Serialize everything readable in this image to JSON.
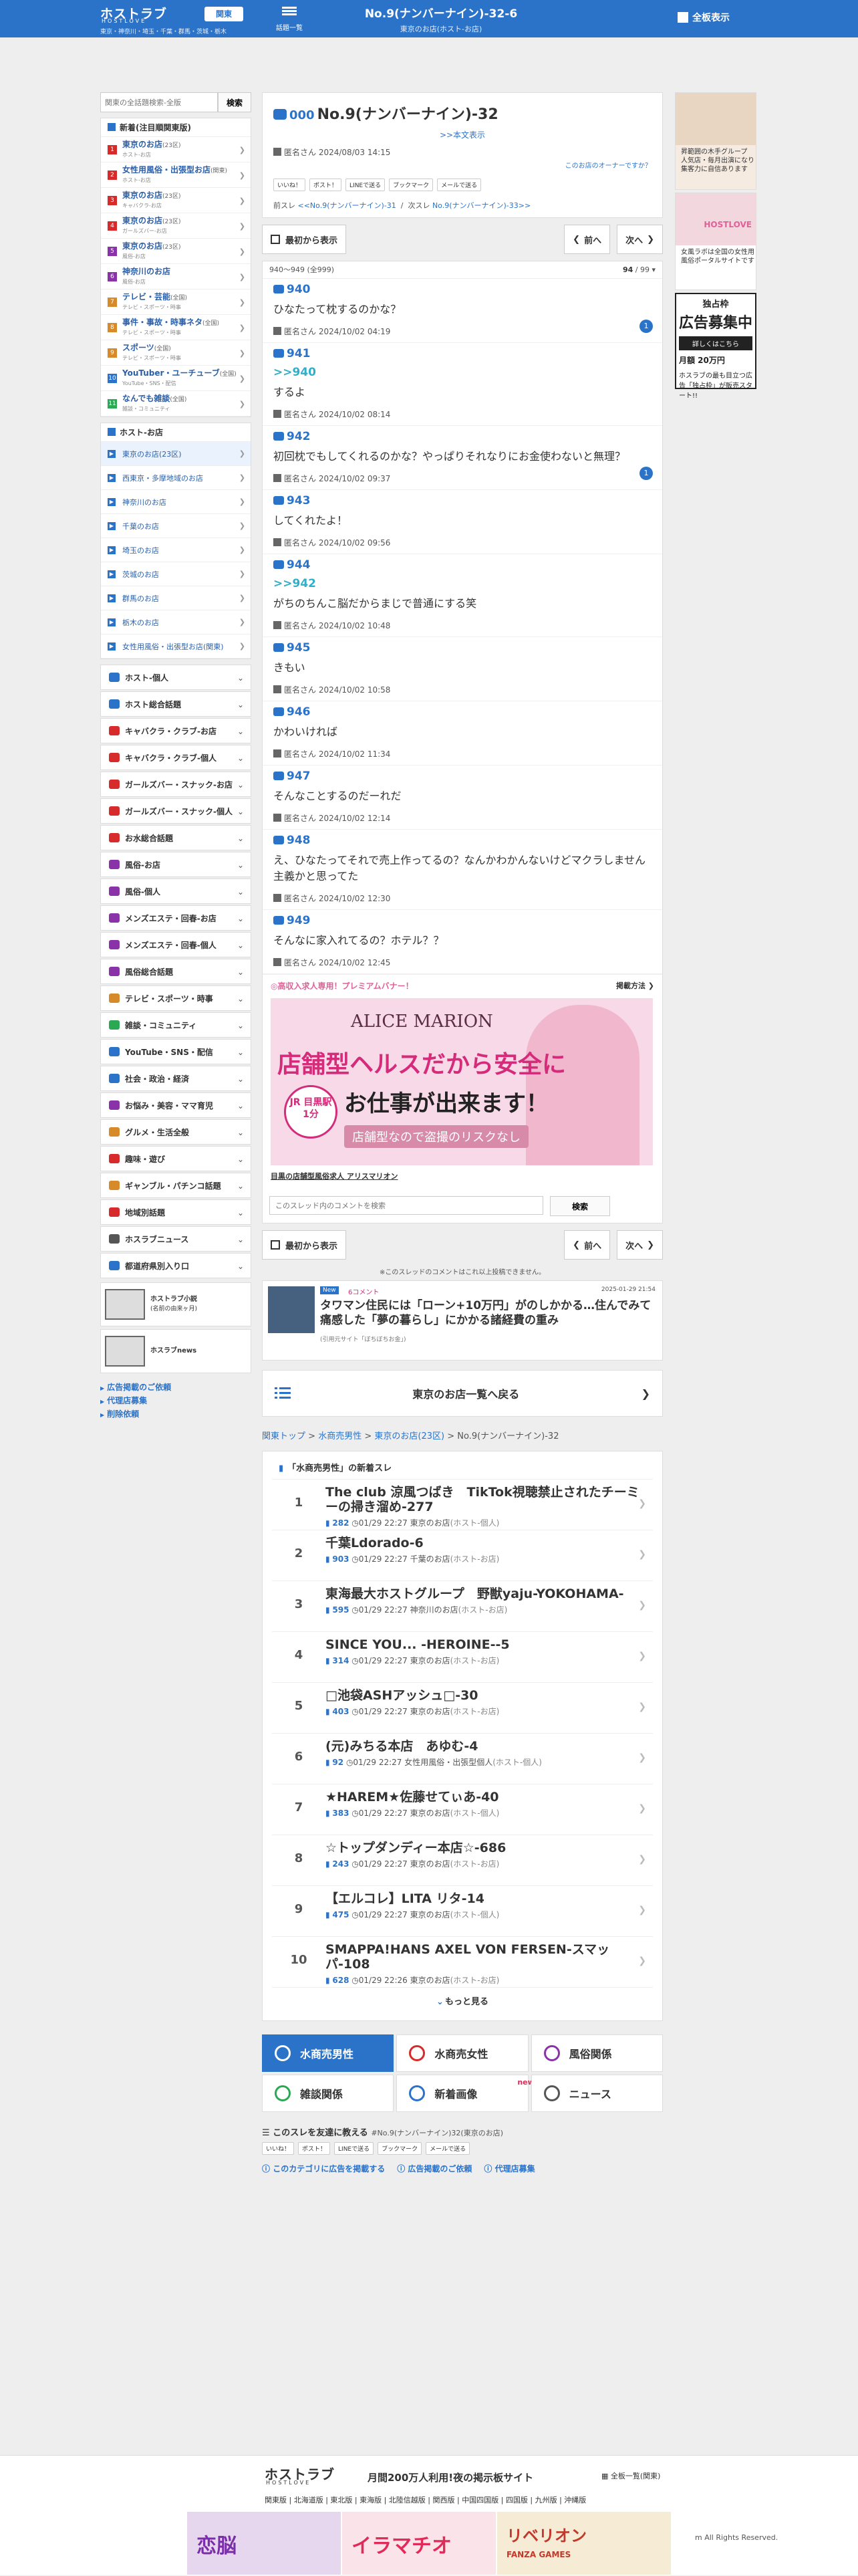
{
  "header": {
    "logo": "ホストラブ",
    "logo_sub": "HOSTLOVE",
    "region_line": "東京・神奈川・埼玉・千葉・群馬・茨城・栃木",
    "kanto_label": "関東",
    "menu_label": "話題一覧",
    "thread_title": "No.9(ナンバーナイン)-32-6",
    "thread_sub": "東京のお店(ホスト-お店)",
    "full_view": "全板表示"
  },
  "left": {
    "search_placeholder": "関東の全話題検索-全版",
    "search_button": "検索",
    "cat_head": "新着(注目順関東版)",
    "categories": [
      {
        "num": "1",
        "name": "東京のお店",
        "tag": "(23区)",
        "sub": "ホスト-お店",
        "color": "#d72a2a"
      },
      {
        "num": "2",
        "name": "女性用風俗・出張型お店",
        "tag": "(関東)",
        "sub": "ホスト-お店",
        "color": "#d72a2a"
      },
      {
        "num": "3",
        "name": "東京のお店",
        "tag": "(23区)",
        "sub": "キャバクラ-お店",
        "color": "#d72a2a"
      },
      {
        "num": "4",
        "name": "東京のお店",
        "tag": "(23区)",
        "sub": "ガールズバー-お店",
        "color": "#d72a2a"
      },
      {
        "num": "5",
        "name": "東京のお店",
        "tag": "(23区)",
        "sub": "風俗-お店",
        "color": "#8a33a8"
      },
      {
        "num": "6",
        "name": "神奈川のお店",
        "tag": "",
        "sub": "風俗-お店",
        "color": "#8a33a8"
      },
      {
        "num": "7",
        "name": "テレビ・芸能",
        "tag": "(全国)",
        "sub": "テレビ・スポーツ・時事",
        "color": "#d78a2a"
      },
      {
        "num": "8",
        "name": "事件・事故・時事ネタ",
        "tag": "(全国)",
        "sub": "テレビ・スポーツ・時事",
        "color": "#d78a2a"
      },
      {
        "num": "9",
        "name": "スポーツ",
        "tag": "(全国)",
        "sub": "テレビ・スポーツ・時事",
        "color": "#d78a2a"
      },
      {
        "num": "10",
        "name": "YouTuber・ユーチューブ",
        "tag": "(全国)",
        "sub": "YouTube・SNS・配信",
        "color": "#2b73c9"
      },
      {
        "num": "11",
        "name": "なんでも雑談",
        "tag": "(全国)",
        "sub": "雑談・コミュニティ",
        "color": "#2aa854"
      }
    ],
    "host_head": "ホスト-お店",
    "host_items": [
      "東京のお店(23区)",
      "西東京・多摩地域のお店",
      "神奈川のお店",
      "千葉のお店",
      "埼玉のお店",
      "茨城のお店",
      "群馬のお店",
      "栃木のお店",
      "女性用風俗・出張型お店(関東)"
    ],
    "genres": [
      {
        "name": "ホスト-個人",
        "color": "#2b73c9"
      },
      {
        "name": "ホスト総合話題",
        "color": "#2b73c9"
      },
      {
        "name": "キャバクラ・クラブ-お店",
        "color": "#d72a2a"
      },
      {
        "name": "キャバクラ・クラブ-個人",
        "color": "#d72a2a"
      },
      {
        "name": "ガールズバー・スナック-お店",
        "color": "#d72a2a"
      },
      {
        "name": "ガールズバー・スナック-個人",
        "color": "#d72a2a"
      },
      {
        "name": "お水総合話題",
        "color": "#d72a2a"
      },
      {
        "name": "風俗-お店",
        "color": "#8a33a8"
      },
      {
        "name": "風俗-個人",
        "color": "#8a33a8"
      },
      {
        "name": "メンズエステ・回春-お店",
        "color": "#8a33a8"
      },
      {
        "name": "メンズエステ・回春-個人",
        "color": "#8a33a8"
      },
      {
        "name": "風俗総合話題",
        "color": "#8a33a8"
      },
      {
        "name": "テレビ・スポーツ・時事",
        "color": "#d78a2a"
      },
      {
        "name": "雑談・コミュニティ",
        "color": "#2aa854"
      },
      {
        "name": "YouTube・SNS・配信",
        "color": "#2b73c9"
      },
      {
        "name": "社会・政治・経済",
        "color": "#2b73c9"
      },
      {
        "name": "お悩み・美容・ママ育児",
        "color": "#8a33a8"
      },
      {
        "name": "グルメ・生活全般",
        "color": "#d78a2a"
      },
      {
        "name": "趣味・遊び",
        "color": "#d72a2a"
      },
      {
        "name": "ギャンブル・パチンコ話題",
        "color": "#d78a2a"
      },
      {
        "name": "地域別話題",
        "color": "#d72a2a"
      },
      {
        "name": "ホスラブニュース",
        "color": "#555555"
      },
      {
        "name": "都道府県別入り口",
        "color": "#2b73c9"
      }
    ],
    "banner1": "ホストラブ小説",
    "banner1_sub": "(名前の由来ヶ月)",
    "banner2": "ホスラブnews",
    "links": [
      "広告掲載のご依頼",
      "代理店募集",
      "削除依頼"
    ]
  },
  "thread": {
    "count": "000",
    "title": "No.9(ナンバーナイン)-32",
    "body_link": ">>本文表示",
    "author": "匿名さん",
    "date": "2024/08/03 14:15",
    "owner_link": "このお店のオーナーですか？",
    "share": [
      "いいね！",
      "ポスト！",
      "LINEで送る",
      "ブックマーク",
      "メールで送る"
    ],
    "prev_label": "前スレ",
    "prev_thread": "<<No.9(ナンバーナイン)-31",
    "next_label": "次スレ",
    "next_thread": "No.9(ナンバーナイン)-33>>"
  },
  "nav": {
    "first": "最初から表示",
    "prev": "前へ",
    "next": "次へ"
  },
  "posts_header": {
    "range": "940〜949",
    "total": "(全999)",
    "page": "94",
    "pages": "99"
  },
  "posts": [
    {
      "no": "940",
      "anchor": "",
      "text": "ひなたって枕するのかな？",
      "author": "匿名さん",
      "date": "2024/10/02 04:19",
      "replies": "1"
    },
    {
      "no": "941",
      "anchor": ">>940",
      "text": "するよ",
      "author": "匿名さん",
      "date": "2024/10/02 08:14",
      "replies": ""
    },
    {
      "no": "942",
      "anchor": "",
      "text": "初回枕でもしてくれるのかな？やっぱりそれなりにお金使わないと無理？",
      "author": "匿名さん",
      "date": "2024/10/02 09:37",
      "replies": "1"
    },
    {
      "no": "943",
      "anchor": "",
      "text": "してくれたよ！",
      "author": "匿名さん",
      "date": "2024/10/02 09:56",
      "replies": ""
    },
    {
      "no": "944",
      "anchor": ">>942",
      "text": "がちのちんこ脳だからまじで普通にする笑",
      "author": "匿名さん",
      "date": "2024/10/02 10:48",
      "replies": ""
    },
    {
      "no": "945",
      "anchor": "",
      "text": "きもい",
      "author": "匿名さん",
      "date": "2024/10/02 10:58",
      "replies": ""
    },
    {
      "no": "946",
      "anchor": "",
      "text": "かわいければ",
      "author": "匿名さん",
      "date": "2024/10/02 11:34",
      "replies": ""
    },
    {
      "no": "947",
      "anchor": "",
      "text": "そんなことするのだーれだ",
      "author": "匿名さん",
      "date": "2024/10/02 12:14",
      "replies": ""
    },
    {
      "no": "948",
      "anchor": "",
      "text": "え、ひなたってそれで売上作ってるの？なんかわかんないけどマクラしません主義かと思ってた",
      "author": "匿名さん",
      "date": "2024/10/02 12:30",
      "replies": ""
    },
    {
      "no": "949",
      "anchor": "",
      "text": "そんなに家入れてるの？ホテル？？",
      "author": "匿名さん",
      "date": "2024/10/02 12:45",
      "replies": ""
    }
  ],
  "premium": {
    "head": "◎高収入求人専用！プレミアムバナー！",
    "method": "掲載方法",
    "brand": "ALICE MARION",
    "line1": "店舗型ヘルスだから安全に",
    "line2": "お仕事が出来ます！",
    "line3": "店舗型なので盗撮のリスクなし",
    "station": "JR 目黒駅 1分",
    "caption": "目黒の店舗型風俗求人 アリスマリオン"
  },
  "comment_search": {
    "placeholder": "このスレッド内のコメントを検索",
    "button": "検索",
    "limit_note": "※このスレッドのコメントはこれ以上投稿できません。"
  },
  "news": {
    "badge": "New",
    "comments": "6コメント",
    "date": "2025-01-29 21:54",
    "title": "タワマン住民には「ローン+10万円」がのしかかる…住んでみて痛感した「夢の暮らし」にかかる諸経費の重み",
    "source": "(引用元サイト「ぼちぼちお金」)"
  },
  "back_list": "東京のお店一覧へ戻る",
  "breadcrumb": [
    "関東トップ",
    "水商売男性",
    "東京のお店(23区)",
    "No.9(ナンバーナイン)-32"
  ],
  "new_threads": {
    "head": "「水商売男性」の新着スレ",
    "items": [
      {
        "rank": "1",
        "title": "The club 涼風つばき　TikTok視聴禁止されたチーミーの掃き溜め-277",
        "count": "282",
        "date": "01/29 22:27",
        "place": "東京のお店",
        "cat": "(ホスト-個人)"
      },
      {
        "rank": "2",
        "title": "千葉Ldorado-6",
        "count": "903",
        "date": "01/29 22:27",
        "place": "千葉のお店",
        "cat": "(ホスト-お店)"
      },
      {
        "rank": "3",
        "title": "東海最大ホストグループ　野獣yaju-YOKOHAMA-",
        "count": "595",
        "date": "01/29 22:27",
        "place": "神奈川のお店",
        "cat": "(ホスト-お店)"
      },
      {
        "rank": "4",
        "title": "SINCE YOU... -HEROINE--5",
        "count": "314",
        "date": "01/29 22:27",
        "place": "東京のお店",
        "cat": "(ホスト-お店)"
      },
      {
        "rank": "5",
        "title": "□池袋ASHアッシュ□-30",
        "count": "403",
        "date": "01/29 22:27",
        "place": "東京のお店",
        "cat": "(ホスト-お店)"
      },
      {
        "rank": "6",
        "title": "(元)みちる本店　あゆむ-4",
        "count": "92",
        "date": "01/29 22:27",
        "place": "女性用風俗・出張型個人",
        "cat": "(ホスト-個人)"
      },
      {
        "rank": "7",
        "title": "★HAREM★佐藤せてぃあ-40",
        "count": "383",
        "date": "01/29 22:27",
        "place": "東京のお店",
        "cat": "(ホスト-個人)"
      },
      {
        "rank": "8",
        "title": "☆トップダンディー本店☆-686",
        "count": "243",
        "date": "01/29 22:27",
        "place": "東京のお店",
        "cat": "(ホスト-お店)"
      },
      {
        "rank": "9",
        "title": "【エルコレ】LITA リタ-14",
        "count": "475",
        "date": "01/29 22:27",
        "place": "東京のお店",
        "cat": "(ホスト-個人)"
      },
      {
        "rank": "10",
        "title": "SMAPPA!HANS AXEL VON FERSEN-スマッパ-108",
        "count": "628",
        "date": "01/29 22:26",
        "place": "東京のお店",
        "cat": "(ホスト-お店)"
      }
    ],
    "more": "もっと見る"
  },
  "cat_grid": [
    {
      "label": "水商売男性",
      "color": "#ffffff",
      "selected": true
    },
    {
      "label": "水商売女性",
      "color": "#d72a2a",
      "selected": false
    },
    {
      "label": "風俗関係",
      "color": "#8a33a8",
      "selected": false
    },
    {
      "label": "雑談関係",
      "color": "#2aa854",
      "selected": false
    },
    {
      "label": "新着画像",
      "color": "#2b73c9",
      "selected": false
    },
    {
      "label": "ニュース",
      "color": "#555555",
      "selected": false
    }
  ],
  "cat_grid_new": "new",
  "tell": {
    "head": "このスレを友達に教える",
    "sub": "#No.9(ナンバーナイン)32(東京のお店)",
    "share": [
      "いいね！",
      "ポスト！",
      "LINEで送る",
      "ブックマーク",
      "メールで送る"
    ],
    "links": [
      "このカテゴリに広告を掲載する",
      "広告掲載のご依頼",
      "代理店募集"
    ]
  },
  "right": {
    "box1_text": "昇範囲の木手グループ 人気店・毎月出演になり 集客力に自信あります",
    "box2_logo": "HOSTLOVE",
    "box2_text": "女風ラボは全国の女性用風俗ポータルサイトです",
    "ad_title": "独占枠",
    "ad_main": "広告募集中",
    "ad_bar": "詳しくはこちら",
    "ad_price": "月額 20万円",
    "ad_note": "ホスラブの最も目立つ広告「独占枠」が販売スタート!!"
  },
  "footer": {
    "logo": "ホストラブ",
    "logo_sub": "HOSTLOVE",
    "tagline": "月間200万人利用!夜の掲示板サイト",
    "all_boards": "全板一覧(関東)",
    "regions": "関東版 | 北海道版 | 東北版 | 東海版 | 北陸信越版 | 関西版 | 中国四国版 | 四国版 | 九州版 | 沖縄版",
    "copyright": "m All Rights Reserved.",
    "banner1": "恋脳",
    "banner2": "イラマチオ",
    "banner3": "リベリオン",
    "banner3_sub": "FANZA GAMES"
  },
  "colors": {
    "brand": "#2b73c9",
    "accent_pink": "#e0609a",
    "link": "#2b73c9"
  }
}
